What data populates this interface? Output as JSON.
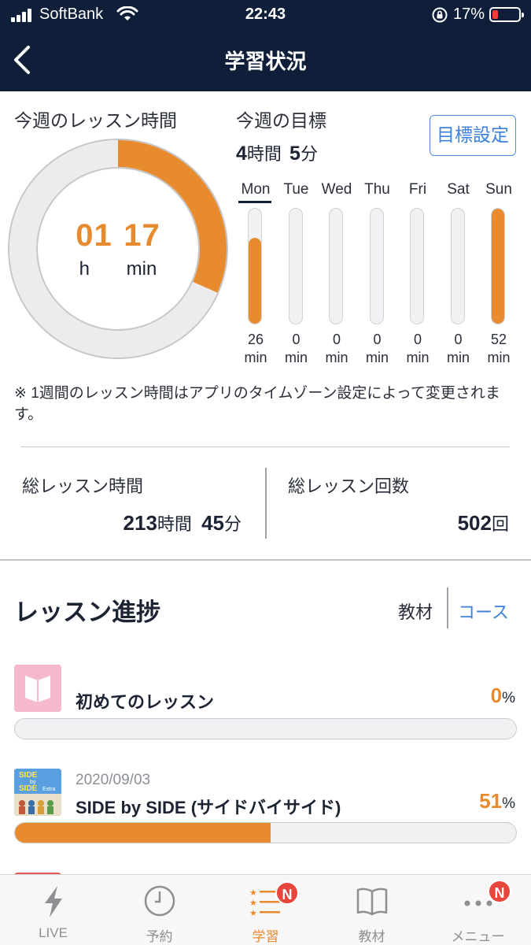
{
  "status_bar": {
    "carrier": "SoftBank",
    "time": "22:43",
    "battery": "17%"
  },
  "nav": {
    "title": "学習状況"
  },
  "weekly": {
    "label": "今週のレッスン時間",
    "hours": "01",
    "minutes": "17",
    "hours_unit": "h",
    "minutes_unit": "min",
    "ring_progress": 0.316,
    "goal_label": "今週の目標",
    "goal_hours": "4",
    "goal_hours_unit": "時間",
    "goal_minutes": "5",
    "goal_minutes_unit": "分",
    "goal_button": "目標設定",
    "selected_day": "Mon",
    "days": [
      {
        "name": "Mon",
        "value": "26",
        "unit": "min",
        "level": 0.75
      },
      {
        "name": "Tue",
        "value": "0",
        "unit": "min",
        "level": 0
      },
      {
        "name": "Wed",
        "value": "0",
        "unit": "min",
        "level": 0
      },
      {
        "name": "Thu",
        "value": "0",
        "unit": "min",
        "level": 0
      },
      {
        "name": "Fri",
        "value": "0",
        "unit": "min",
        "level": 0
      },
      {
        "name": "Sat",
        "value": "0",
        "unit": "min",
        "level": 0
      },
      {
        "name": "Sun",
        "value": "52",
        "unit": "min",
        "level": 1.0
      }
    ],
    "note": "※ 1週間のレッスン時間はアプリのタイムゾーン設定によって変更されます。"
  },
  "totals": {
    "time_label": "総レッスン時間",
    "time_hours": "213",
    "time_hours_unit": "時間",
    "time_minutes": "45",
    "time_minutes_unit": "分",
    "count_label": "総レッスン回数",
    "count": "502",
    "count_unit": "回"
  },
  "progress": {
    "title": "レッスン進捗",
    "tab_materials": "教材",
    "tab_courses": "コース",
    "courses": [
      {
        "date": "",
        "name": "初めてのレッスン",
        "percent": "0",
        "percent_unit": "%",
        "fraction": 0.0,
        "thumb_color": "#f5b8cf"
      },
      {
        "date": "2020/09/03",
        "name": "SIDE by SIDE (サイドバイサイド)",
        "percent": "51",
        "percent_unit": "%",
        "fraction": 0.51,
        "thumb_color": "#3a78c0"
      }
    ],
    "thumb_text_1": "SIDE",
    "thumb_text_2": "by",
    "thumb_text_3": "SIDE",
    "thumb_text_4": "Extra"
  },
  "tabbar": {
    "tabs": [
      {
        "label": "LIVE",
        "icon": "bolt-icon"
      },
      {
        "label": "予約",
        "icon": "clock-icon"
      },
      {
        "label": "学習",
        "icon": "list-stars-icon",
        "badge": "N"
      },
      {
        "label": "教材",
        "icon": "book-icon"
      },
      {
        "label": "メニュー",
        "icon": "more-dots-icon",
        "badge": "N"
      }
    ],
    "active": "学習"
  },
  "colors": {
    "navy": "#0f1f3a",
    "accent_orange": "#e88a2e",
    "link_blue": "#3b82dd",
    "badge_red": "#e8453c"
  }
}
